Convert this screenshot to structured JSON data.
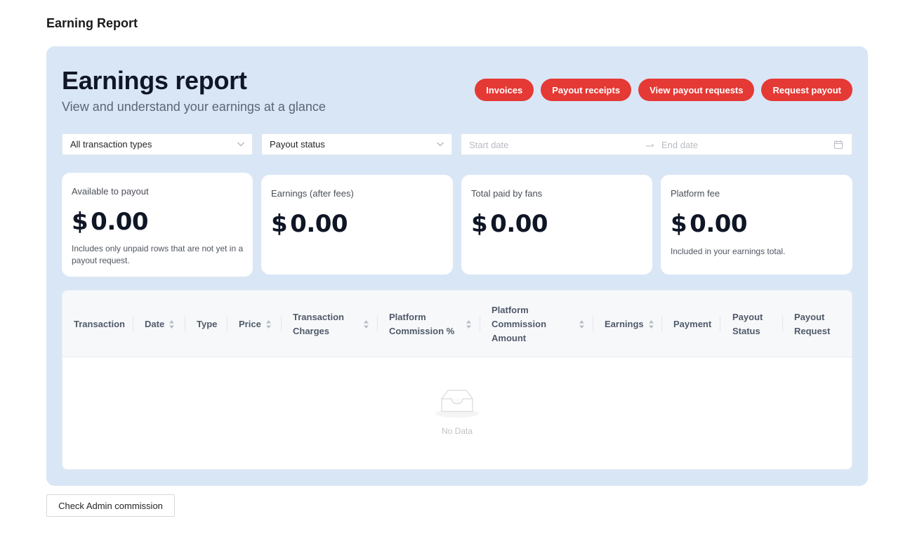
{
  "page": {
    "title": "Earning Report"
  },
  "hero": {
    "title": "Earnings report",
    "subtitle": "View and understand your earnings at a glance"
  },
  "actions": {
    "invoices": "Invoices",
    "payout_receipts": "Payout receipts",
    "view_payout_requests": "View payout requests",
    "request_payout": "Request payout"
  },
  "filters": {
    "transaction_type": "All transaction types",
    "payout_status": "Payout status",
    "start_placeholder": "Start date",
    "end_placeholder": "End date"
  },
  "cards": [
    {
      "label": "Available to payout",
      "currency": "$",
      "amount": "0.00",
      "note": "Includes only unpaid rows that are not yet in a payout request."
    },
    {
      "label": "Earnings (after fees)",
      "currency": "$",
      "amount": "0.00",
      "note": ""
    },
    {
      "label": "Total paid by fans",
      "currency": "$",
      "amount": "0.00",
      "note": ""
    },
    {
      "label": "Platform fee",
      "currency": "$",
      "amount": "0.00",
      "note": "Included in your earnings total."
    }
  ],
  "table": {
    "columns": [
      {
        "line1": "Transaction",
        "line2": "",
        "line3": ""
      },
      {
        "line1": "Date",
        "line2": "",
        "line3": ""
      },
      {
        "line1": "Type",
        "line2": "",
        "line3": ""
      },
      {
        "line1": "Price",
        "line2": "",
        "line3": ""
      },
      {
        "line1": "Transaction",
        "line2": "Charges",
        "line3": ""
      },
      {
        "line1": "Platform",
        "line2": "Commission %",
        "line3": ""
      },
      {
        "line1": "Platform",
        "line2": "Commission",
        "line3": "Amount"
      },
      {
        "line1": "Earnings",
        "line2": "",
        "line3": ""
      },
      {
        "line1": "Payment",
        "line2": "",
        "line3": ""
      },
      {
        "line1": "Payout",
        "line2": "Status",
        "line3": ""
      },
      {
        "line1": "Payout",
        "line2": "Request",
        "line3": ""
      }
    ],
    "empty_text": "No Data"
  },
  "footer": {
    "admin_button": "Check Admin commission"
  },
  "colors": {
    "accent": "#e53935",
    "panel": "#d9e6f6"
  },
  "icons": {
    "select": "chevron-down-icon",
    "date_sep": "arrow-right-icon",
    "calendar": "calendar-icon",
    "sort": "sort-icon",
    "empty": "empty-inbox-icon"
  }
}
